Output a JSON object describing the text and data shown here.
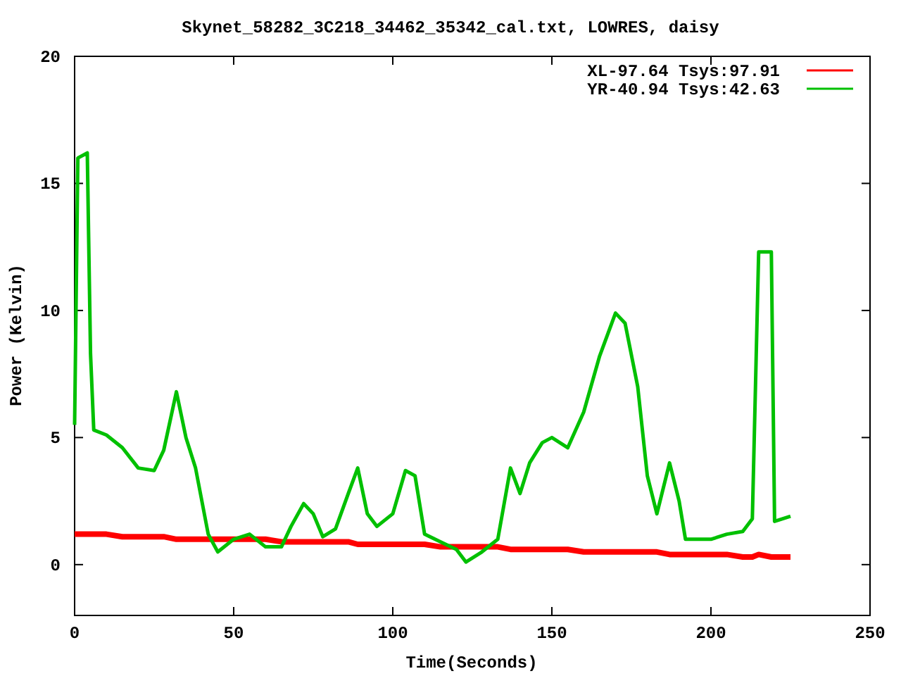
{
  "chart_data": {
    "type": "line",
    "title": "Skynet_58282_3C218_34462_35342_cal.txt, LOWRES, daisy",
    "xlabel": "Time(Seconds)",
    "ylabel": "Power (Kelvin)",
    "x": [
      0,
      1,
      4,
      5,
      6,
      10,
      15,
      20,
      25,
      28,
      32,
      35,
      38,
      42,
      45,
      50,
      55,
      60,
      65,
      68,
      72,
      75,
      78,
      82,
      86,
      89,
      92,
      95,
      100,
      104,
      107,
      110,
      115,
      120,
      123,
      128,
      133,
      137,
      140,
      143,
      147,
      150,
      155,
      160,
      165,
      170,
      173,
      177,
      180,
      183,
      187,
      190,
      192,
      200,
      205,
      210,
      213,
      215,
      219,
      220,
      225
    ],
    "series": [
      {
        "name": "XL-97.64 Tsys:97.91",
        "color": "#ff0000",
        "values": [
          1.2,
          1.2,
          1.2,
          1.2,
          1.2,
          1.2,
          1.1,
          1.1,
          1.1,
          1.1,
          1.0,
          1.0,
          1.0,
          1.0,
          1.0,
          1.0,
          1.0,
          1.0,
          0.9,
          0.9,
          0.9,
          0.9,
          0.9,
          0.9,
          0.9,
          0.8,
          0.8,
          0.8,
          0.8,
          0.8,
          0.8,
          0.8,
          0.7,
          0.7,
          0.7,
          0.7,
          0.7,
          0.6,
          0.6,
          0.6,
          0.6,
          0.6,
          0.6,
          0.5,
          0.5,
          0.5,
          0.5,
          0.5,
          0.5,
          0.5,
          0.4,
          0.4,
          0.4,
          0.4,
          0.4,
          0.3,
          0.3,
          0.4,
          0.3,
          0.3,
          0.3
        ]
      },
      {
        "name": "YR-40.94 Tsys:42.63",
        "color": "#00c000",
        "values": [
          5.5,
          16,
          16.2,
          8.3,
          5.3,
          5.1,
          4.6,
          3.8,
          3.7,
          4.5,
          6.8,
          5,
          3.8,
          1.2,
          0.5,
          1,
          1.2,
          0.7,
          0.7,
          1.5,
          2.4,
          2,
          1.1,
          1.4,
          2.8,
          3.8,
          2,
          1.5,
          2,
          3.7,
          3.5,
          1.2,
          0.9,
          0.6,
          0.1,
          0.5,
          1,
          3.8,
          2.8,
          4,
          4.8,
          5,
          4.6,
          6,
          8.2,
          9.9,
          9.5,
          7,
          3.5,
          2,
          4,
          2.5,
          1,
          1,
          1.2,
          1.3,
          1.8,
          12.3,
          12.3,
          1.7,
          1.9
        ]
      }
    ],
    "legend": true,
    "xlim": [
      0,
      250
    ],
    "ylim": [
      -2,
      20
    ],
    "xticks": [
      0,
      50,
      100,
      150,
      200,
      250
    ],
    "yticks": [
      0,
      5,
      10,
      15,
      20
    ]
  }
}
